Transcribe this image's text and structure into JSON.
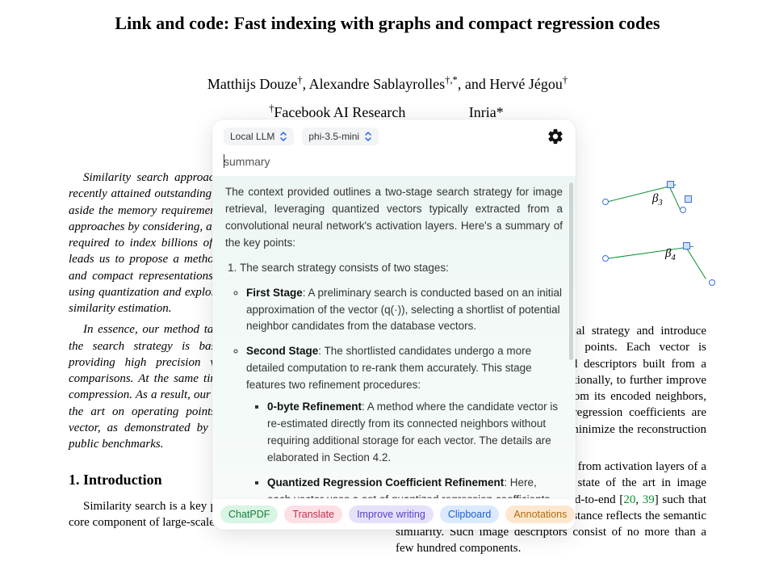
{
  "paper": {
    "title": "Link and code: Fast indexing with graphs and compact regression codes",
    "authors_html": "Matthijs Douze†, Alexandre Sablayrolles†,*, and Hervé Jégou†",
    "affil1_prefix": "†",
    "affil1": "Facebook AI Research",
    "affil2_prefix": "*",
    "affil2": "Inria*",
    "abstract_p1": "Similarity search approaches based on graph walks have recently attained outstanding speed-accuracy trade-offs, taking aside the memory requirements. In this paper, we revisit these approaches by considering, additionally, the memory constraint required to index billions of images on a single server. This leads us to propose a method based both on graph traversal and compact representations. We encode the indexed vectors using quantization and exploit the graph structure to refine the similarity estimation.",
    "abstract_p2": "In essence, our method takes the best of these two worlds: the search strategy is based on nested graphs, thereby providing high precision with a relatively small set of comparisons. At the same time it offers a significant memory compression. As a result, our approach outperforms the state of the art on operating points considering 64–128 bytes per vector, as demonstrated by our results on two billion-scale public benchmarks.",
    "section1_title": "1. Introduction",
    "intro_p1": "Similarity search is a key problem in computer vision. It is a core component of large-scale image search [",
    "right_p1": "oach: we adopt a graph traversal strategy and introduce connectivity between all database points. Each vector is approximated based on compressed descriptors built from a vector (circle) is approximated, additionally, to further improve the estimate given the encodings from its encoded neighbors, by using a regression basis. The regression coefficients are selected from a codebook learnt to minimize the reconstruction error.",
    "right_p2": "ted by an unique vector, extracted from activation layers of a convolutional neural network. The state of the art in image retrieval learns the representation end-to-end [",
    "cite1": "20",
    "cite2": "39",
    "right_p2_tail": "] such that the cosine similarity or Euclidean distance reflects the semantic similarity. Such image descriptors consist of no more than a few hundred components.",
    "fig_beta3": "β",
    "fig_beta3_sub": "3",
    "fig_beta4": "β",
    "fig_beta4_sub": "4"
  },
  "panel": {
    "model_provider": "Local LLM",
    "model_name": "phi-3.5-mini",
    "query": "summary",
    "intro": "The context provided outlines a two-stage search strategy for image retrieval, leveraging quantized vectors typically extracted from a convolutional neural network's activation layers. Here's a summary of the key points:",
    "ol1": "The search strategy consists of two stages:",
    "stage1_label": "First Stage",
    "stage1_text": ": A preliminary search is conducted based on an initial approximation of the vector (q(·)), selecting a shortlist of potential neighbor candidates from the database vectors.",
    "stage2_label": "Second Stage",
    "stage2_text": ": The shortlisted candidates undergo a more detailed computation to re-rank them accurately. This stage features two refinement procedures:",
    "ref1_label": "0-byte Refinement",
    "ref1_text": ": A method where the candidate vector is re-estimated directly from its connected neighbors without requiring additional storage for each vector. The details are elaborated in Section 4.2.",
    "ref2_label": "Quantized Regression Coefficient Refinement",
    "ref2_text": ": Here, each vector uses a set of quantized regression coefficients that are learned and"
  },
  "footer": {
    "chatpdf": "ChatPDF",
    "translate": "Translate",
    "improve": "Improve writing",
    "clipboard": "Clipboard",
    "annotations": "Annotations"
  }
}
